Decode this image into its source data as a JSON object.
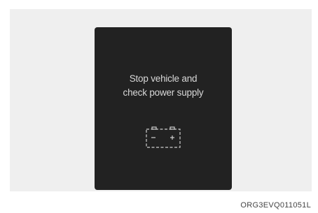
{
  "display": {
    "message_line1": "Stop vehicle and",
    "message_line2": "check power supply",
    "icon": "battery-icon"
  },
  "caption": "ORG3EVQ011051L",
  "colors": {
    "background": "#ffffff",
    "panel": "#efefef",
    "screen": "#222222",
    "text": "#d8d8d8"
  }
}
